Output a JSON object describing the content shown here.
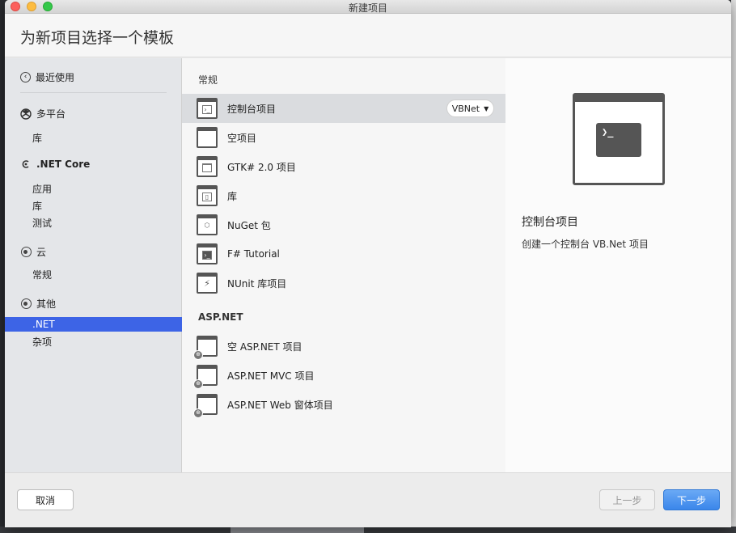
{
  "window": {
    "title": "新建项目"
  },
  "header": {
    "title": "为新项目选择一个模板"
  },
  "sidebar": {
    "recent": "最近使用",
    "categories": [
      {
        "label": "多平台",
        "icon": "multiplatform-icon",
        "subs": [
          "库"
        ]
      },
      {
        "label": ".NET Core",
        "icon": "netcore-icon",
        "subs": [
          "应用",
          "库",
          "测试"
        ]
      },
      {
        "label": "云",
        "icon": "cloud-icon",
        "subs": [
          "常规"
        ]
      },
      {
        "label": "其他",
        "icon": "other-icon",
        "subs": [
          ".NET",
          "杂项"
        ]
      }
    ],
    "selected": ".NET"
  },
  "templates": {
    "general_title": "常规",
    "general": [
      {
        "label": "控制台项目",
        "icon": "console-template-icon",
        "selected": true
      },
      {
        "label": "空项目",
        "icon": "empty-template-icon"
      },
      {
        "label": "GTK# 2.0 项目",
        "icon": "gtk-template-icon"
      },
      {
        "label": "库",
        "icon": "library-template-icon"
      },
      {
        "label": "NuGet 包",
        "icon": "nuget-template-icon"
      },
      {
        "label": "F# Tutorial",
        "icon": "fsharp-template-icon"
      },
      {
        "label": "NUnit 库项目",
        "icon": "nunit-template-icon"
      }
    ],
    "aspnet_title": "ASP.NET",
    "aspnet": [
      {
        "label": "空 ASP.NET 项目",
        "icon": "aspnet-empty-template-icon"
      },
      {
        "label": "ASP.NET MVC 项目",
        "icon": "aspnet-mvc-template-icon"
      },
      {
        "label": "ASP.NET Web 窗体项目",
        "icon": "aspnet-webforms-template-icon"
      }
    ],
    "language": "VBNet"
  },
  "preview": {
    "title": "控制台项目",
    "description": "创建一个控制台 VB.Net 项目",
    "prompt_glyph": "❯_"
  },
  "footer": {
    "cancel": "取消",
    "prev": "上一步",
    "next": "下一步"
  },
  "colors": {
    "selection": "#3d64e6",
    "primary_button": "#3e8ef0"
  }
}
